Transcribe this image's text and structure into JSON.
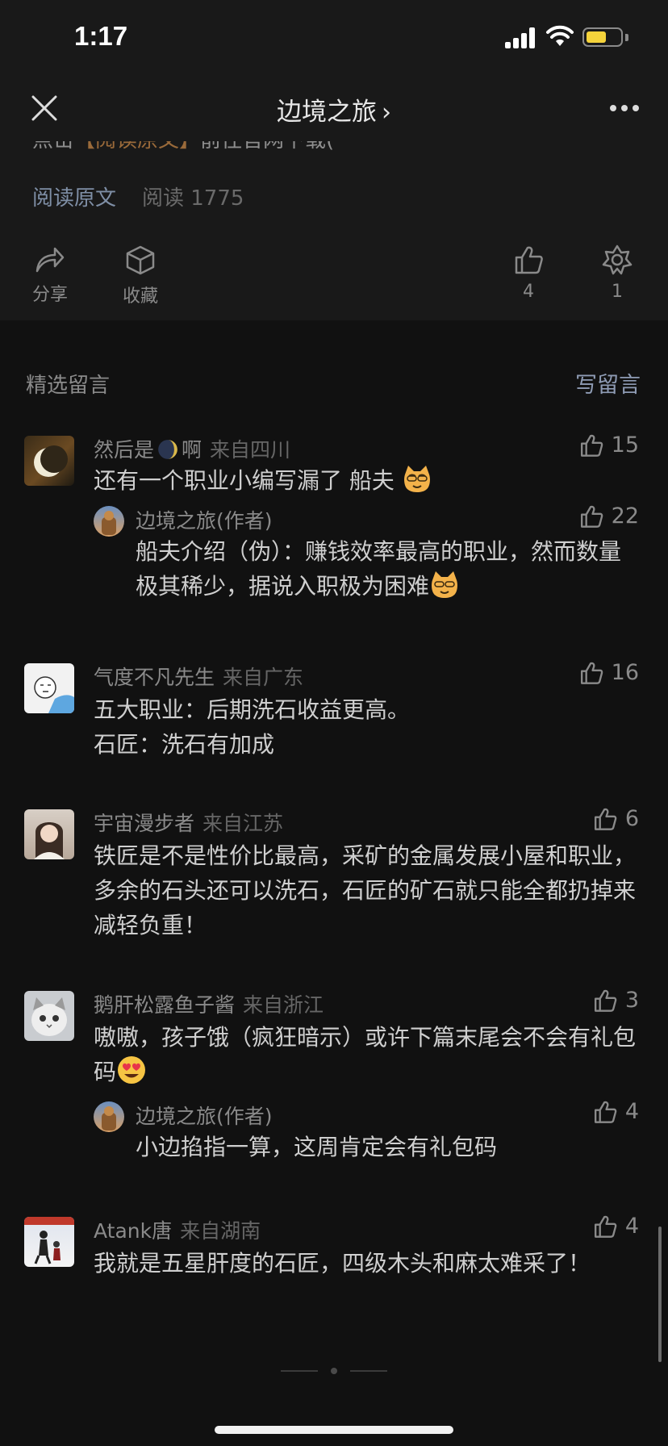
{
  "status_bar": {
    "time": "1:17",
    "battery_color": "#f5d33b"
  },
  "nav": {
    "title": "边境之旅",
    "chevron": "›",
    "close_icon": "close-icon",
    "more_icon": "more-icon"
  },
  "article": {
    "clipped_line_a": "点击",
    "clipped_line_b": "【阅读原文】",
    "clipped_line_c": "前往官网下载(",
    "read_original": "阅读原文",
    "read_count": "阅读 1775",
    "actions": {
      "share": "分享",
      "favorite": "收藏",
      "likes": "4",
      "wow": "1"
    }
  },
  "comments_section": {
    "title": "精选留言",
    "write": "写留言"
  },
  "comments": [
    {
      "name_a": "然后是",
      "name_b": "啊",
      "region": "来自四川",
      "likes": "15",
      "text": "还有一个职业小编写漏了 船夫",
      "reply": {
        "name": "边境之旅(作者)",
        "likes": "22",
        "text": "船夫介绍（伪）：赚钱效率最高的职业，然而数量极其稀少，据说入职极为困难"
      }
    },
    {
      "name": "气度不凡先生",
      "region": "来自广东",
      "likes": "16",
      "line1": "五大职业：后期洗石收益更高。",
      "line2": "石匠：洗石有加成"
    },
    {
      "name": "宇宙漫步者",
      "region": "来自江苏",
      "likes": "6",
      "text": "铁匠是不是性价比最高，采矿的金属发展小屋和职业，多余的石头还可以洗石，石匠的矿石就只能全都扔掉来减轻负重！"
    },
    {
      "name": "鹅肝松露鱼子酱",
      "region": "来自浙江",
      "likes": "3",
      "text": "嗷嗷，孩子饿（疯狂暗示）或许下篇末尾会不会有礼包码",
      "reply": {
        "name": "边境之旅(作者)",
        "likes": "4",
        "text": "小边掐指一算，这周肯定会有礼包码"
      }
    },
    {
      "name": "Atank唐",
      "region": "来自湖南",
      "likes": "4",
      "text": "我就是五星肝度的石匠，四级木头和麻太难采了！"
    }
  ]
}
